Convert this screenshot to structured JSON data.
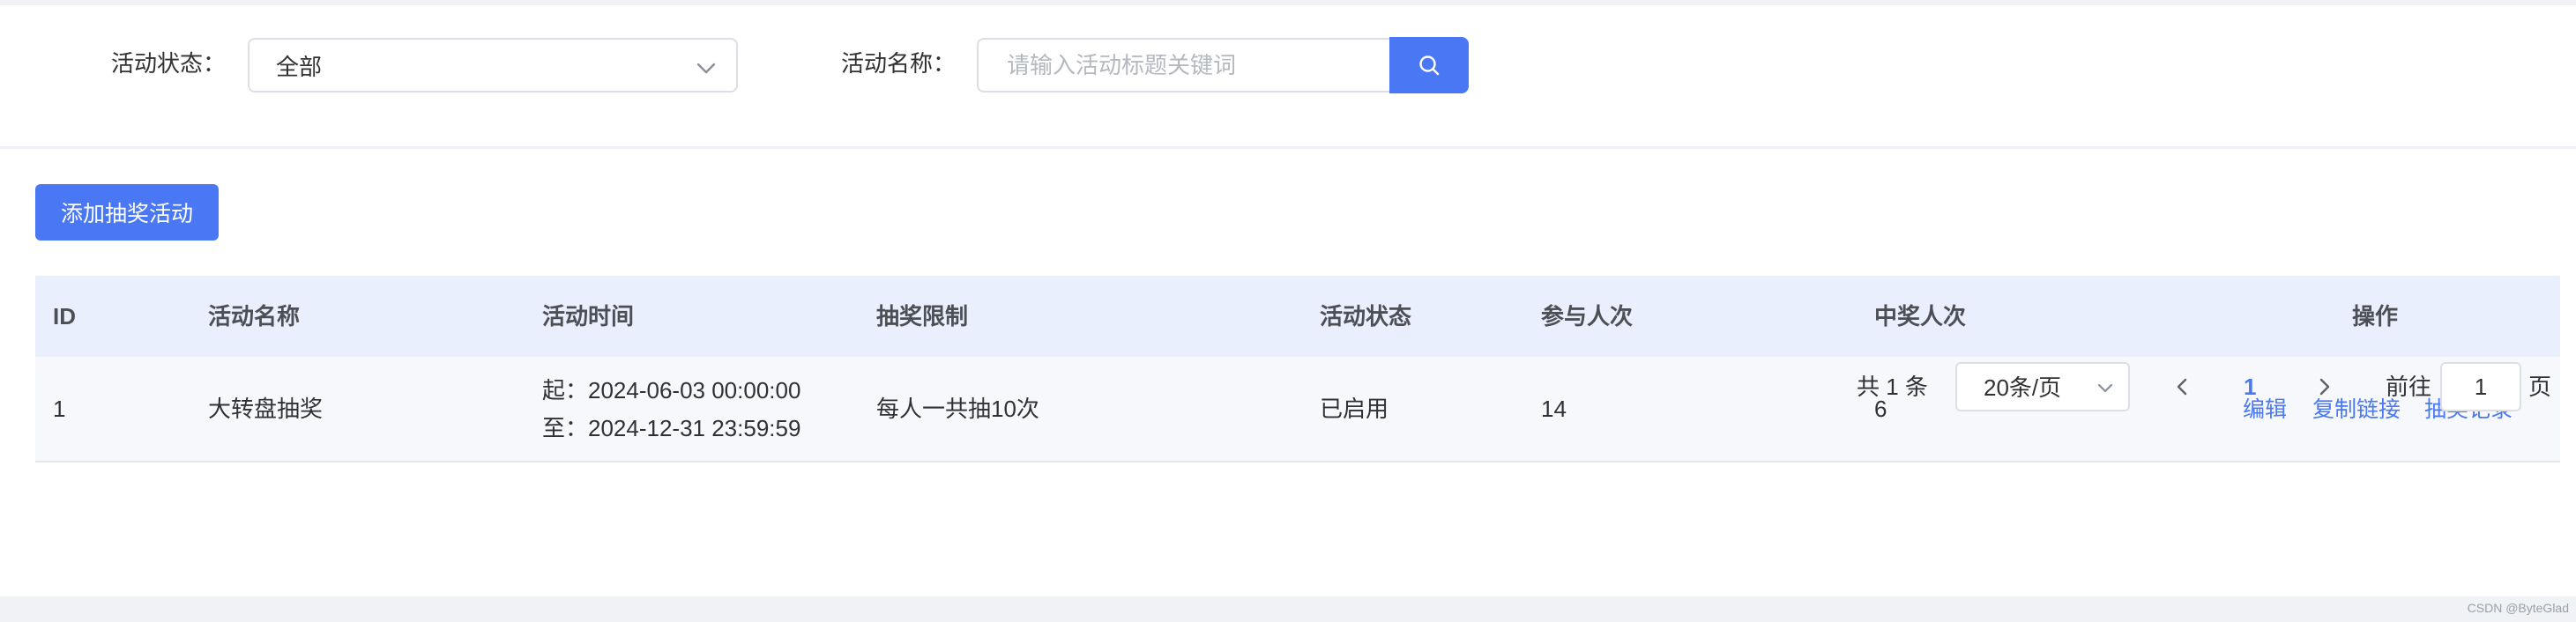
{
  "filters": {
    "status_label": "活动状态：",
    "status_value": "全部",
    "name_label": "活动名称：",
    "name_placeholder": "请输入活动标题关键词",
    "name_value": ""
  },
  "toolbar": {
    "add_label": "添加抽奖活动"
  },
  "table": {
    "columns": [
      "ID",
      "活动名称",
      "活动时间",
      "抽奖限制",
      "活动状态",
      "参与人次",
      "中奖人次",
      "操作"
    ],
    "rows": [
      {
        "id": "1",
        "name": "大转盘抽奖",
        "time_start": "起：2024-06-03 00:00:00",
        "time_end": "至：2024-12-31 23:59:59",
        "limit": "每人一共抽10次",
        "status": "已启用",
        "participants": "14",
        "winners": "6",
        "actions": [
          "编辑",
          "复制链接",
          "抽奖记录"
        ]
      }
    ]
  },
  "pagination": {
    "total_text": "共 1 条",
    "page_size": "20条/页",
    "current_page": "1",
    "goto_prefix": "前往",
    "goto_value": "1",
    "goto_suffix": "页"
  },
  "watermark": "CSDN @ByteGlad",
  "colors": {
    "primary": "#4a78f4",
    "header_bg": "#e9effd",
    "page_bg": "#f0f2f5"
  },
  "icons": {
    "select": "chevron-down-icon",
    "search": "search-icon",
    "prev": "chevron-left-icon",
    "next": "chevron-right-icon"
  }
}
